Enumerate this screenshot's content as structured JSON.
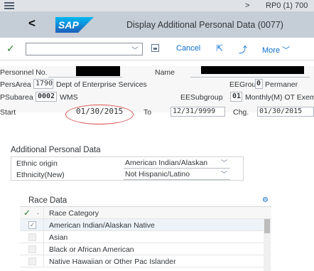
{
  "system": {
    "arrow": ">",
    "text": "RP0 (1) 700"
  },
  "shell": {
    "back": "<",
    "logo_text": "SAP",
    "title": "Display Additional Personal Data (0077)"
  },
  "toolbar": {
    "cancel_label": "Cancel",
    "more_label": "More",
    "command_value": ""
  },
  "header": {
    "personnel_no_label": "Personnel No.",
    "name_label": "Name",
    "persarea_label": "PersArea",
    "persarea_code": "1790",
    "persarea_text": "Dept of Enterprise Services",
    "eegroup_label": "EEGroup",
    "eegroup_code": "0",
    "eegroup_text": "Permaner",
    "psubarea_label": "PSubarea",
    "psubarea_code": "0002",
    "psubarea_text": "WMS",
    "eesubgroup_label": "EESubgroup",
    "eesubgroup_code": "01",
    "eesubgroup_text": "Monthly(M) OT Exem...",
    "start_label": "Start",
    "start_value": "01/30/2015",
    "to_label": "To",
    "to_value": "12/31/9999",
    "chg_label": "Chg.",
    "chg_value": "01/30/2015"
  },
  "additional": {
    "title": "Additional Personal Data",
    "ethnic_origin_label": "Ethnic origin",
    "ethnic_origin_value": "American Indian/Alaskan",
    "ethnicity_new_label": "Ethnicity(New)",
    "ethnicity_new_value": "Not Hispanic/Latino"
  },
  "race": {
    "title": "Race Data",
    "header_dot": ".",
    "column": "Race Category",
    "rows": [
      {
        "label": "American Indian/Alaskan Native",
        "checked": true
      },
      {
        "label": "Asian",
        "checked": false
      },
      {
        "label": "Black or African American",
        "checked": false
      },
      {
        "label": "Native Hawaiian or Other Pac Islander",
        "checked": false
      }
    ]
  },
  "colors": {
    "accent": "#0a6ed1",
    "annotation": "#d9534f",
    "ok": "#2b7c2b"
  }
}
